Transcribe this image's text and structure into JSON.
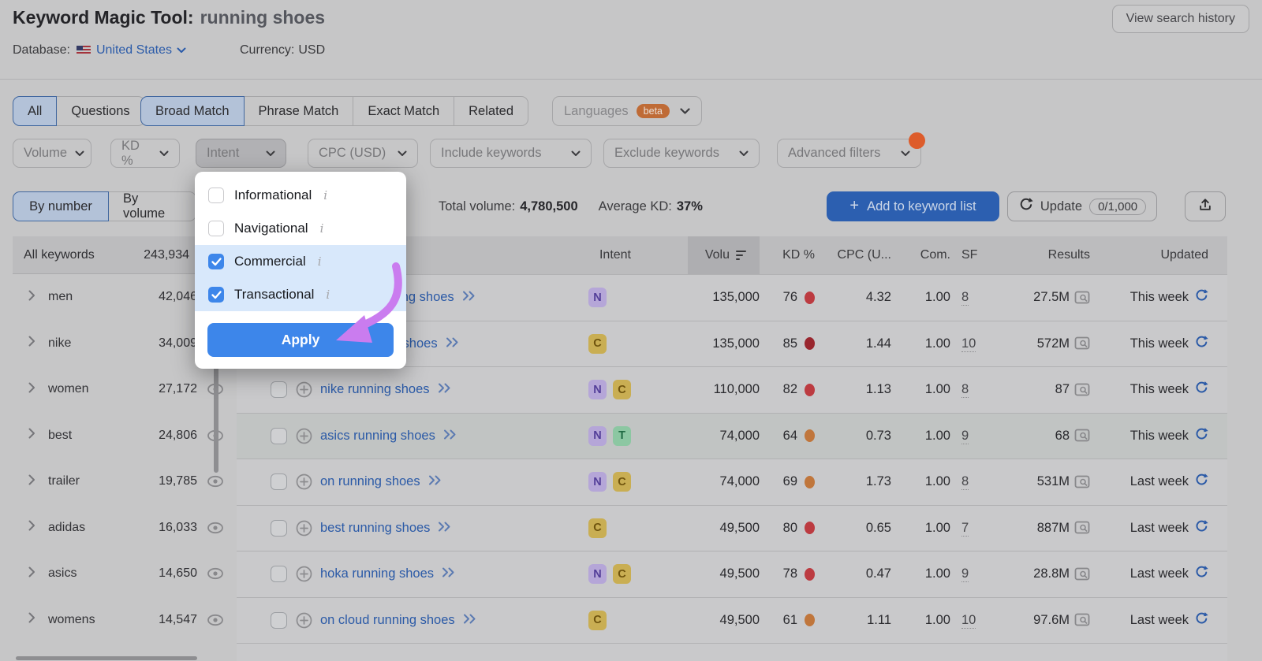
{
  "header": {
    "title": "Keyword Magic Tool:",
    "query": "running shoes",
    "view_search_history": "View search history",
    "database_label": "Database:",
    "database_value": "United States",
    "currency_label": "Currency:",
    "currency_value": "USD"
  },
  "match_tabs": {
    "groups": [
      {
        "items": [
          {
            "label": "All",
            "selected": true
          },
          {
            "label": "Questions",
            "selected": false
          }
        ]
      },
      {
        "items": [
          {
            "label": "Broad Match",
            "selected": true
          },
          {
            "label": "Phrase Match",
            "selected": false
          },
          {
            "label": "Exact Match",
            "selected": false
          },
          {
            "label": "Related",
            "selected": false
          }
        ]
      }
    ],
    "languages_label": "Languages",
    "languages_badge": "beta"
  },
  "filters": [
    "Volume",
    "KD %",
    "Intent",
    "CPC (USD)",
    "Include keywords",
    "Exclude keywords",
    "Advanced filters"
  ],
  "intent_popup": {
    "options": [
      {
        "label": "Informational",
        "checked": false,
        "highlight": false
      },
      {
        "label": "Navigational",
        "checked": false,
        "highlight": false
      },
      {
        "label": "Commercial",
        "checked": true,
        "highlight": true
      },
      {
        "label": "Transactional",
        "checked": true,
        "highlight": true
      }
    ],
    "apply_label": "Apply"
  },
  "toolbar": {
    "view_toggle": [
      {
        "label": "By number",
        "selected": true
      },
      {
        "label": "By volume",
        "selected": false
      }
    ],
    "all_keywords_label": "All keywords:",
    "all_keywords_value": "243,934",
    "total_volume_label": "Total volume:",
    "total_volume_value": "4,780,500",
    "average_kd_label": "Average KD:",
    "average_kd_value": "37%",
    "add_button_label": "Add to keyword list",
    "update_label": "Update",
    "update_count": "0/1,000"
  },
  "sidebar": {
    "header": {
      "label": "All keywords",
      "count": "243,934"
    },
    "groups": [
      {
        "name": "men",
        "count": "42,046"
      },
      {
        "name": "nike",
        "count": "34,009"
      },
      {
        "name": "women",
        "count": "27,172"
      },
      {
        "name": "best",
        "count": "24,806"
      },
      {
        "name": "trailer",
        "count": "19,785"
      },
      {
        "name": "adidas",
        "count": "16,033"
      },
      {
        "name": "asics",
        "count": "14,650"
      },
      {
        "name": "womens",
        "count": "14,547"
      }
    ]
  },
  "table": {
    "columns": {
      "intent": "Intent",
      "volume": "Volu",
      "kd": "KD %",
      "cpc": "CPC (U...",
      "com": "Com.",
      "sf": "SF",
      "results": "Results",
      "updated": "Updated"
    },
    "intent_badges": {
      "N": {
        "bg": "#b5a6d8",
        "fg": "#533e99"
      },
      "C": {
        "bg": "#c9ae53",
        "fg": "#6f540e"
      },
      "T": {
        "bg": "#8cc7a2",
        "fg": "#216b44"
      }
    },
    "kd_colors": {
      "difficult": "#c0763c",
      "hard": "#bc3b41",
      "very_hard": "#99262e"
    },
    "rows": [
      {
        "keyword": "womens running shoes",
        "intents": [
          "N"
        ],
        "volume": "135,000",
        "kd": "76",
        "kd_color": "#bc3b41",
        "cpc": "4.32",
        "com": "1.00",
        "sf": "8",
        "results": "27.5M",
        "updated": "This week",
        "highlight": false
      },
      {
        "keyword": "mens running shoes",
        "intents": [
          "C"
        ],
        "volume": "135,000",
        "kd": "85",
        "kd_color": "#99262e",
        "cpc": "1.44",
        "com": "1.00",
        "sf": "10",
        "results": "572M",
        "updated": "This week",
        "highlight": false
      },
      {
        "keyword": "nike running shoes",
        "intents": [
          "N",
          "C"
        ],
        "volume": "110,000",
        "kd": "82",
        "kd_color": "#bc3b41",
        "cpc": "1.13",
        "com": "1.00",
        "sf": "8",
        "results": "87",
        "updated": "This week",
        "highlight": false
      },
      {
        "keyword": "asics running shoes",
        "intents": [
          "N",
          "T"
        ],
        "volume": "74,000",
        "kd": "64",
        "kd_color": "#c0763c",
        "cpc": "0.73",
        "com": "1.00",
        "sf": "9",
        "results": "68",
        "updated": "This week",
        "highlight": true
      },
      {
        "keyword": "on running shoes",
        "intents": [
          "N",
          "C"
        ],
        "volume": "74,000",
        "kd": "69",
        "kd_color": "#c0763c",
        "cpc": "1.73",
        "com": "1.00",
        "sf": "8",
        "results": "531M",
        "updated": "Last week",
        "highlight": false
      },
      {
        "keyword": "best running shoes",
        "intents": [
          "C"
        ],
        "volume": "49,500",
        "kd": "80",
        "kd_color": "#bc3b41",
        "cpc": "0.65",
        "com": "1.00",
        "sf": "7",
        "results": "887M",
        "updated": "Last week",
        "highlight": false
      },
      {
        "keyword": "hoka running shoes",
        "intents": [
          "N",
          "C"
        ],
        "volume": "49,500",
        "kd": "78",
        "kd_color": "#bc3b41",
        "cpc": "0.47",
        "com": "1.00",
        "sf": "9",
        "results": "28.8M",
        "updated": "Last week",
        "highlight": false
      },
      {
        "keyword": "on cloud running shoes",
        "intents": [
          "C"
        ],
        "volume": "49,500",
        "kd": "61",
        "kd_color": "#c0763c",
        "cpc": "1.11",
        "com": "1.00",
        "sf": "10",
        "results": "97.6M",
        "updated": "Last week",
        "highlight": false
      }
    ]
  }
}
